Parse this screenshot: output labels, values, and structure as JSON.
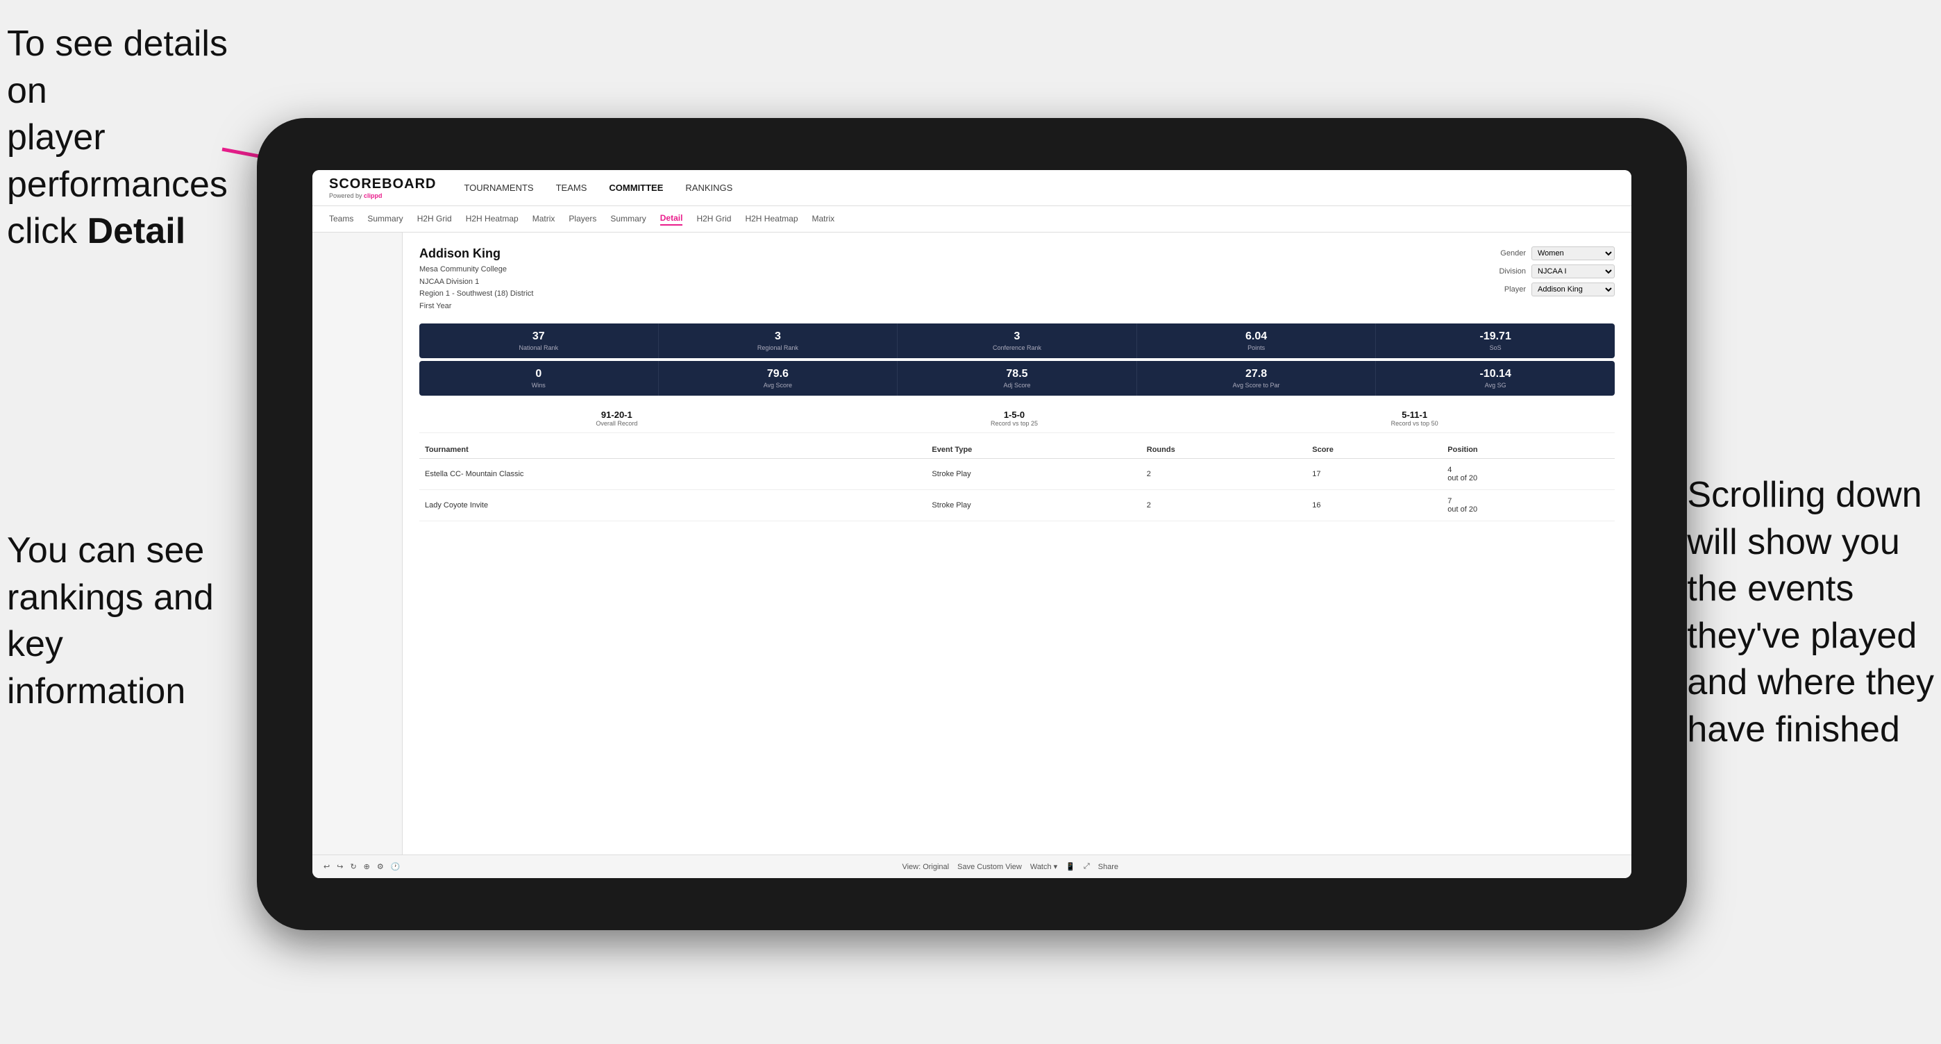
{
  "annotations": {
    "top_left_line1": "To see details on",
    "top_left_line2": "player performances",
    "top_left_line3": "click ",
    "top_left_bold": "Detail",
    "bottom_left_line1": "You can see",
    "bottom_left_line2": "rankings and",
    "bottom_left_line3": "key information",
    "right_line1": "Scrolling down",
    "right_line2": "will show you",
    "right_line3": "the events",
    "right_line4": "they've played",
    "right_line5": "and where they",
    "right_line6": "have finished"
  },
  "header": {
    "logo": "SCOREBOARD",
    "logo_sub": "Powered by clippd",
    "nav": [
      "TOURNAMENTS",
      "TEAMS",
      "COMMITTEE",
      "RANKINGS"
    ]
  },
  "sub_nav": [
    "Teams",
    "Summary",
    "H2H Grid",
    "H2H Heatmap",
    "Matrix",
    "Players",
    "Summary",
    "Detail",
    "H2H Grid",
    "H2H Heatmap",
    "Matrix"
  ],
  "active_sub_nav": "Detail",
  "player": {
    "name": "Addison King",
    "college": "Mesa Community College",
    "division": "NJCAA Division 1",
    "region": "Region 1 - Southwest (18) District",
    "year": "First Year",
    "gender_label": "Gender",
    "gender_value": "Women",
    "division_label": "Division",
    "division_value": "NJCAA I",
    "player_label": "Player",
    "player_value": "Addison King"
  },
  "stats_row1": [
    {
      "value": "37",
      "label": "National Rank"
    },
    {
      "value": "3",
      "label": "Regional Rank"
    },
    {
      "value": "3",
      "label": "Conference Rank"
    },
    {
      "value": "6.04",
      "label": "Points"
    },
    {
      "value": "-19.71",
      "label": "SoS"
    }
  ],
  "stats_row2": [
    {
      "value": "0",
      "label": "Wins"
    },
    {
      "value": "79.6",
      "label": "Avg Score"
    },
    {
      "value": "78.5",
      "label": "Adj Score"
    },
    {
      "value": "27.8",
      "label": "Avg Score to Par"
    },
    {
      "value": "-10.14",
      "label": "Avg SG"
    }
  ],
  "records": [
    {
      "value": "91-20-1",
      "label": "Overall Record"
    },
    {
      "value": "1-5-0",
      "label": "Record vs top 25"
    },
    {
      "value": "5-11-1",
      "label": "Record vs top 50"
    }
  ],
  "table": {
    "headers": [
      "Tournament",
      "",
      "Event Type",
      "Rounds",
      "Score",
      "Position"
    ],
    "rows": [
      {
        "tournament": "Estella CC- Mountain Classic",
        "event_type": "Stroke Play",
        "rounds": "2",
        "score": "17",
        "position": "4\nout of 20"
      },
      {
        "tournament": "Lady Coyote Invite",
        "event_type": "Stroke Play",
        "rounds": "2",
        "score": "16",
        "position": "7\nout of 20"
      }
    ]
  },
  "toolbar": {
    "undo": "↩",
    "redo": "↪",
    "view_original": "View: Original",
    "save_custom": "Save Custom View",
    "watch": "Watch",
    "share": "Share"
  }
}
